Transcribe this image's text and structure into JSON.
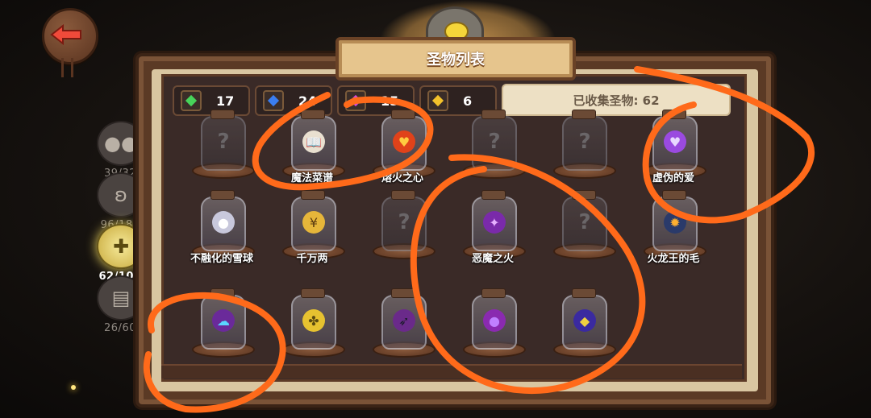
{
  "title": "圣物列表",
  "colors": {
    "accent": "#ff6a1a",
    "green_gem": "#47d35a",
    "blue_gem": "#3a7ef0",
    "purple_gem": "#d84ae0",
    "gold_gem": "#f3c22b"
  },
  "currencies": [
    {
      "name": "green-gem",
      "value": "17"
    },
    {
      "name": "blue-gem",
      "value": "24"
    },
    {
      "name": "purple-gem",
      "value": "15"
    },
    {
      "name": "gold-gem",
      "value": "6"
    }
  ],
  "collected_label": "已收集圣物: 62",
  "side_tabs": [
    {
      "icon": "cookie-pets-icon",
      "count": "39/32"
    },
    {
      "icon": "monster-face-icon",
      "count": "96/184"
    },
    {
      "icon": "relic-jar-icon",
      "count": "62/107"
    },
    {
      "icon": "lock-icon",
      "count": "26/60"
    }
  ],
  "items": [
    {
      "label": "",
      "icon": "question-mark-icon",
      "empty": true
    },
    {
      "label": "魔法菜谱",
      "icon": "magic-recipe-book-icon",
      "empty": false
    },
    {
      "label": "熔火之心",
      "icon": "molten-heart-icon",
      "empty": false
    },
    {
      "label": "",
      "icon": "question-mark-icon",
      "empty": true
    },
    {
      "label": "",
      "icon": "question-mark-icon",
      "empty": true
    },
    {
      "label": "虚伪的爱",
      "icon": "false-love-heart-icon",
      "empty": false
    },
    {
      "label": "不融化的雪球",
      "icon": "snowball-icon",
      "empty": false
    },
    {
      "label": "千万两",
      "icon": "gold-coin-icon",
      "empty": false
    },
    {
      "label": "",
      "icon": "question-mark-icon",
      "empty": true
    },
    {
      "label": "恶魔之火",
      "icon": "demon-fire-icon",
      "empty": false
    },
    {
      "label": "",
      "icon": "question-mark-icon",
      "empty": true
    },
    {
      "label": "火龙王的毛",
      "icon": "fire-dragon-fur-icon",
      "empty": false
    },
    {
      "label": "",
      "icon": "blue-spirit-icon",
      "empty": false
    },
    {
      "label": "",
      "icon": "clover-coin-icon",
      "empty": false
    },
    {
      "label": "",
      "icon": "claw-icon",
      "empty": false
    },
    {
      "label": "",
      "icon": "purple-orb-icon",
      "empty": false
    },
    {
      "label": "",
      "icon": "gold-crystal-icon",
      "empty": false
    }
  ]
}
